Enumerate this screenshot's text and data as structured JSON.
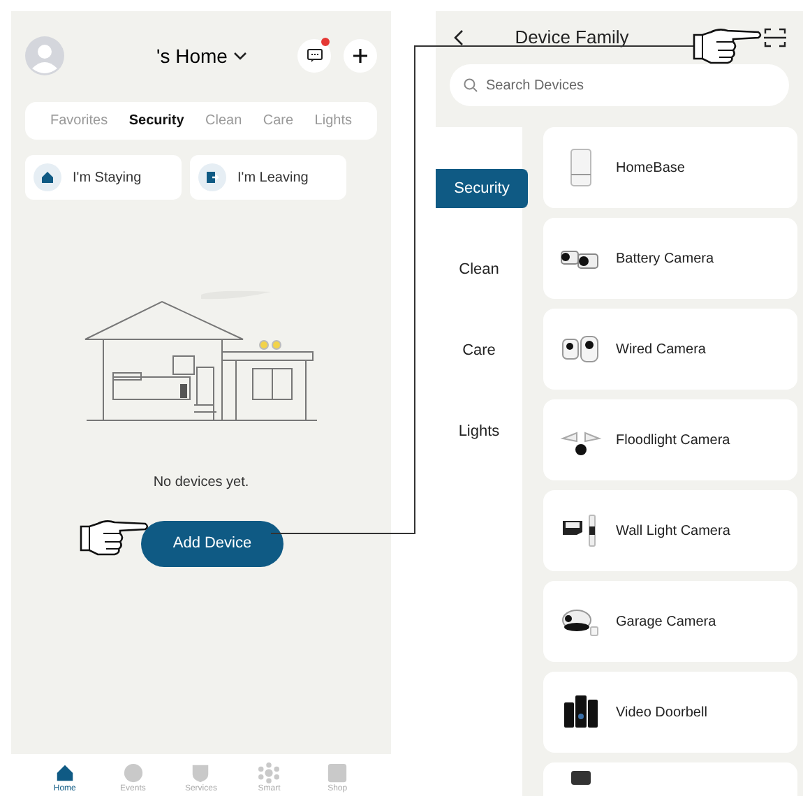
{
  "home_screen": {
    "title": "'s Home",
    "messages": {
      "has_notification": true
    },
    "tabs": [
      {
        "label": "Favorites",
        "selected": false
      },
      {
        "label": "Security",
        "selected": true
      },
      {
        "label": "Clean",
        "selected": false
      },
      {
        "label": "Care",
        "selected": false
      },
      {
        "label": "Lights",
        "selected": false
      }
    ],
    "mode_buttons": [
      {
        "label": "I'm Staying",
        "kind": "stay"
      },
      {
        "label": "I'm Leaving",
        "kind": "leave"
      }
    ],
    "empty_text": "No devices yet.",
    "add_button": "Add Device",
    "bottom_nav": [
      {
        "label": "Home",
        "kind": "home",
        "selected": true
      },
      {
        "label": "Events",
        "kind": "events",
        "selected": false
      },
      {
        "label": "Services",
        "kind": "services",
        "selected": false
      },
      {
        "label": "Smart",
        "kind": "smart",
        "selected": false
      },
      {
        "label": "Shop",
        "kind": "shop",
        "selected": false
      }
    ]
  },
  "device_screen": {
    "title": "Device Family",
    "search": {
      "placeholder": "Search Devices"
    },
    "categories": [
      {
        "label": "Security",
        "selected": true
      },
      {
        "label": "Clean",
        "selected": false
      },
      {
        "label": "Care",
        "selected": false
      },
      {
        "label": "Lights",
        "selected": false
      }
    ],
    "devices": [
      {
        "name": "HomeBase",
        "kind": "homebase"
      },
      {
        "name": "Battery Camera",
        "kind": "battery"
      },
      {
        "name": "Wired Camera",
        "kind": "wired"
      },
      {
        "name": "Floodlight Camera",
        "kind": "floodlight"
      },
      {
        "name": "Wall Light Camera",
        "kind": "walllight"
      },
      {
        "name": "Garage Camera",
        "kind": "garage"
      },
      {
        "name": "Video Doorbell",
        "kind": "doorbell"
      },
      {
        "kind": "partial"
      }
    ]
  }
}
